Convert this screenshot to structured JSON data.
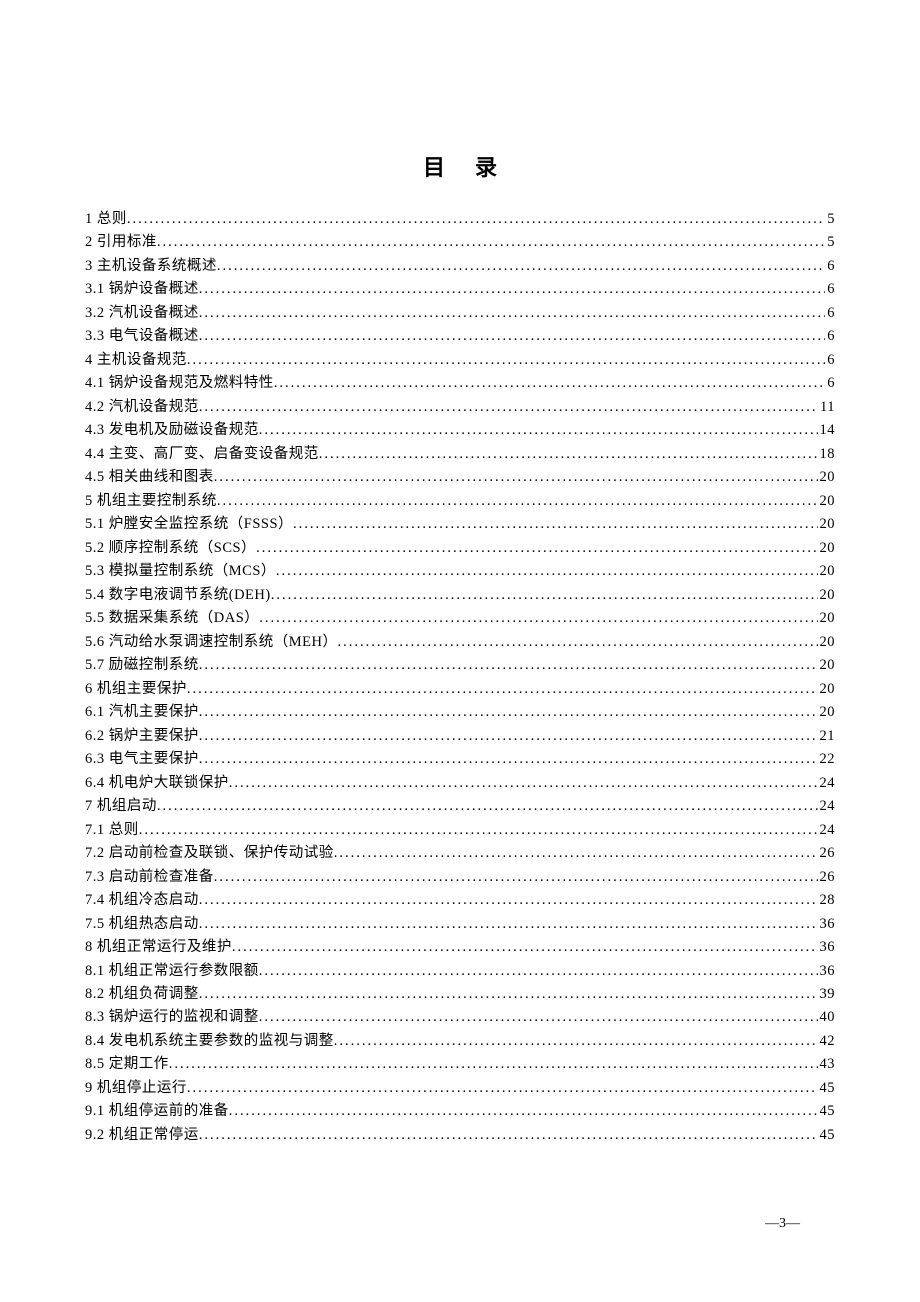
{
  "title": "目录",
  "page_label": "—3—",
  "toc": [
    {
      "num": "1",
      "text": "总则",
      "page": "5"
    },
    {
      "num": "2",
      "text": "引用标准",
      "page": "5"
    },
    {
      "num": "3",
      "text": "主机设备系统概述",
      "page": "6"
    },
    {
      "num": "3.1",
      "text": "锅炉设备概述",
      "page": "6"
    },
    {
      "num": "3.2",
      "text": "汽机设备概述",
      "page": "6"
    },
    {
      "num": "3.3",
      "text": "电气设备概述",
      "page": "6"
    },
    {
      "num": "4",
      "text": "主机设备规范",
      "page": "6"
    },
    {
      "num": "4.1",
      "text": "锅炉设备规范及燃料特性",
      "page": "6"
    },
    {
      "num": "4.2",
      "text": "汽机设备规范",
      "page": "11"
    },
    {
      "num": "4.3",
      "text": "发电机及励磁设备规范",
      "page": "14"
    },
    {
      "num": "4.4",
      "text": "主变、高厂变、启备变设备规范",
      "page": "18"
    },
    {
      "num": "4.5",
      "text": "相关曲线和图表",
      "page": "20"
    },
    {
      "num": "5",
      "text": "机组主要控制系统",
      "page": "20"
    },
    {
      "num": "5.1",
      "text": "炉膛安全监控系统（FSSS）",
      "page": "20"
    },
    {
      "num": "5.2",
      "text": "顺序控制系统（SCS）",
      "page": "20"
    },
    {
      "num": "5.3",
      "text": "模拟量控制系统（MCS）",
      "page": "20"
    },
    {
      "num": "5.4",
      "text": "数字电液调节系统(DEH)",
      "page": "20"
    },
    {
      "num": "5.5",
      "text": "数据采集系统（DAS）",
      "page": "20"
    },
    {
      "num": "5.6",
      "text": "汽动给水泵调速控制系统（MEH）",
      "page": "20"
    },
    {
      "num": "5.7",
      "text": "励磁控制系统",
      "page": "20"
    },
    {
      "num": "6",
      "text": "机组主要保护",
      "page": "20"
    },
    {
      "num": "6.1",
      "text": "汽机主要保护",
      "page": "20"
    },
    {
      "num": "6.2",
      "text": "锅炉主要保护",
      "page": "21"
    },
    {
      "num": "6.3",
      "text": "电气主要保护",
      "page": "22"
    },
    {
      "num": "6.4",
      "text": "机电炉大联锁保护",
      "page": "24"
    },
    {
      "num": "7",
      "text": "机组启动",
      "page": "24"
    },
    {
      "num": "7.1",
      "text": "总则",
      "page": "24"
    },
    {
      "num": "7.2",
      "text": "启动前检查及联锁、保护传动试验",
      "page": "26"
    },
    {
      "num": "7.3",
      "text": "启动前检查准备",
      "page": "26"
    },
    {
      "num": "7.4",
      "text": "机组冷态启动",
      "page": "28"
    },
    {
      "num": "7.5",
      "text": "机组热态启动",
      "page": "36"
    },
    {
      "num": "8",
      "text": "机组正常运行及维护",
      "page": "36"
    },
    {
      "num": "8.1",
      "text": "机组正常运行参数限额",
      "page": "36"
    },
    {
      "num": "8.2",
      "text": "机组负荷调整",
      "page": "39"
    },
    {
      "num": "8.3",
      "text": "锅炉运行的监视和调整",
      "page": "40"
    },
    {
      "num": "8.4",
      "text": "发电机系统主要参数的监视与调整",
      "page": "42"
    },
    {
      "num": "8.5",
      "text": "定期工作",
      "page": "43"
    },
    {
      "num": "9",
      "text": "机组停止运行",
      "page": "45"
    },
    {
      "num": "9.1",
      "text": "机组停运前的准备",
      "page": "45"
    },
    {
      "num": "9.2",
      "text": "机组正常停运",
      "page": "45"
    }
  ]
}
